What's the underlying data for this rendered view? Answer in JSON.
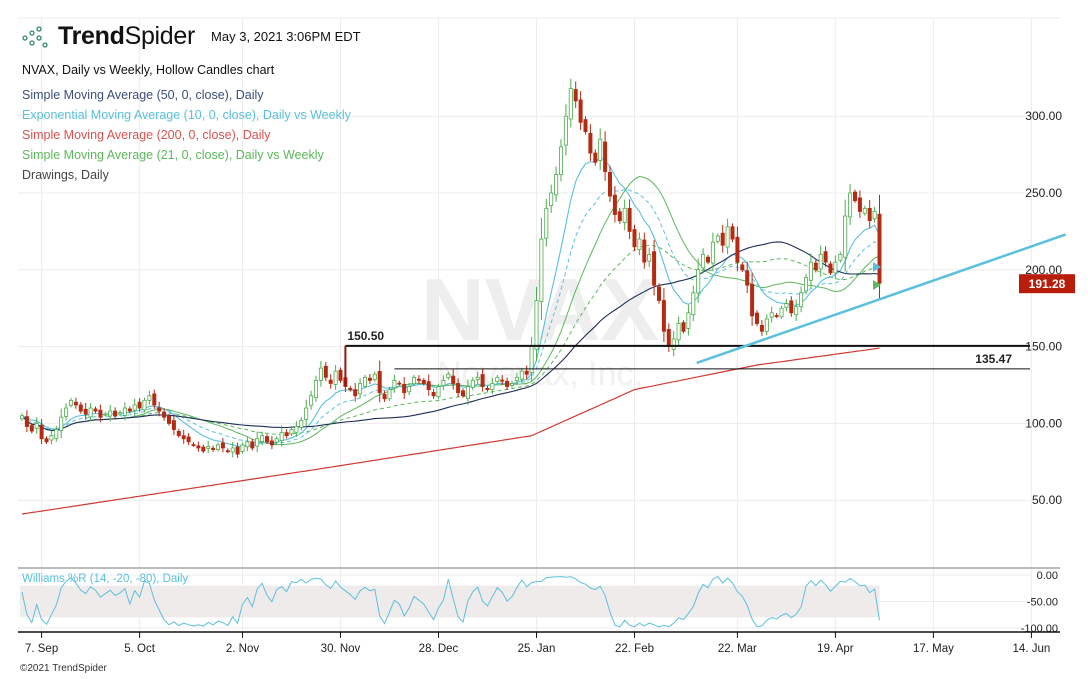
{
  "header": {
    "brand_bold": "Trend",
    "brand_light": "Spider",
    "timestamp": "May 3, 2021 3:06PM EDT"
  },
  "legend": [
    {
      "label": "NVAX, Daily vs Weekly, Hollow Candles chart",
      "color": "#111111"
    },
    {
      "label": "Simple Moving Average (50, 0, close), Daily",
      "color": "#3a4f7a"
    },
    {
      "label": "Exponential Moving Average (10, 0, close), Daily vs Weekly",
      "color": "#5bc0de"
    },
    {
      "label": "Simple Moving Average (200, 0, close), Daily",
      "color": "#d9534f"
    },
    {
      "label": "Simple Moving Average (21, 0, close), Daily vs Weekly",
      "color": "#5cb85c"
    },
    {
      "label": "Drawings, Daily",
      "color": "#444444"
    }
  ],
  "watermark": {
    "symbol": "NVAX",
    "company": "Novavax, Inc."
  },
  "footer": {
    "copyright": "©2021 TrendSpider"
  },
  "colors": {
    "up": "#4cae4c",
    "down": "#b52a12",
    "sma50": "#1f2f5c",
    "ema10": "#5bc0de",
    "sma200": "#d03b32",
    "sma21": "#5cb85c",
    "trendline": "#5bc0de",
    "price_tag": "#b81d0c"
  },
  "chart_data": {
    "type": "candlestick",
    "symbol": "NVAX",
    "y_ticks": [
      300,
      250,
      200,
      150,
      100,
      50
    ],
    "y_tick_labels": [
      "300.00",
      "250.00",
      "200.00",
      "150.00",
      "100.00",
      "50.00"
    ],
    "x_labels": [
      "7. Sep",
      "5. Oct",
      "2. Nov",
      "30. Nov",
      "28. Dec",
      "25. Jan",
      "22. Feb",
      "22. Mar",
      "19. Apr",
      "17. May",
      "14. Jun"
    ],
    "x_label_index": [
      4,
      24,
      45,
      65,
      85,
      105,
      125,
      146,
      166,
      186,
      206
    ],
    "last_price": "191.28",
    "closes": [
      105,
      98,
      95,
      100,
      90,
      88,
      92,
      96,
      104,
      110,
      115,
      112,
      108,
      106,
      110,
      108,
      104,
      106,
      108,
      105,
      107,
      110,
      108,
      112,
      110,
      115,
      118,
      112,
      108,
      104,
      100,
      96,
      92,
      90,
      88,
      86,
      84,
      82,
      85,
      83,
      86,
      84,
      82,
      84,
      80,
      86,
      88,
      84,
      90,
      92,
      88,
      86,
      90,
      94,
      92,
      96,
      98,
      102,
      110,
      118,
      128,
      136,
      130,
      126,
      134,
      128,
      124,
      122,
      118,
      126,
      130,
      128,
      132,
      120,
      116,
      122,
      128,
      126,
      120,
      124,
      130,
      128,
      126,
      122,
      118,
      124,
      128,
      132,
      126,
      120,
      118,
      124,
      128,
      130,
      124,
      122,
      126,
      130,
      128,
      124,
      126,
      130,
      134,
      132,
      150,
      180,
      220,
      240,
      250,
      262,
      280,
      300,
      318,
      310,
      296,
      290,
      276,
      270,
      285,
      264,
      248,
      236,
      232,
      240,
      225,
      215,
      220,
      205,
      210,
      190,
      180,
      160,
      150,
      155,
      165,
      160,
      172,
      185,
      200,
      210,
      205,
      218,
      222,
      216,
      228,
      220,
      205,
      200,
      190,
      170,
      165,
      160,
      168,
      172,
      170,
      175,
      178,
      172,
      176,
      185,
      195,
      205,
      200,
      210,
      205,
      198,
      205,
      210,
      235,
      250,
      245,
      238,
      240,
      232,
      238,
      191.28
    ],
    "sma200_keypoints": [
      [
        0,
        41
      ],
      [
        60,
        70
      ],
      [
        104,
        92
      ],
      [
        125,
        122
      ],
      [
        150,
        138
      ],
      [
        175,
        149
      ]
    ],
    "horizontal_levels": [
      {
        "value": 150.5,
        "label": "150.50",
        "start_index": 66
      },
      {
        "value": 135.47,
        "label": "135.47",
        "start_index": 76
      }
    ],
    "trendline": {
      "from": [
        133,
        140
      ],
      "to": [
        213,
        223
      ]
    },
    "oscillator": {
      "name": "Williams %R (14, -20, -80), Daily",
      "ticks": [
        "0.00",
        "-50.00",
        "-100.00"
      ],
      "tick_values": [
        0,
        -50,
        -100
      ],
      "upper": -20,
      "lower": -80,
      "period": 14
    }
  }
}
